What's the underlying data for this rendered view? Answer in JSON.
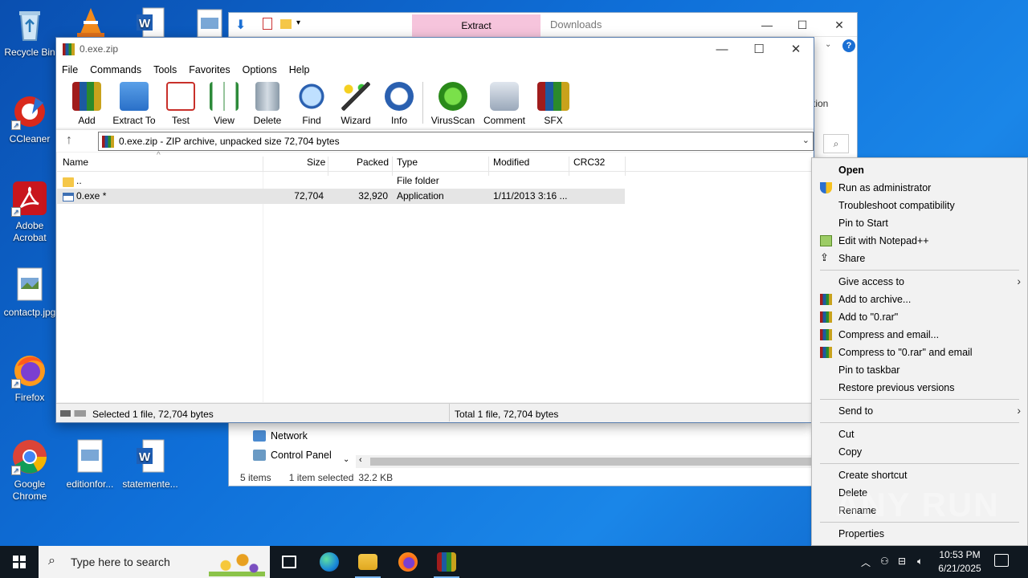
{
  "desktop": {
    "icons": [
      {
        "label": "Recycle Bin"
      },
      {
        "label": "CCleaner"
      },
      {
        "label": "Adobe Acrobat"
      },
      {
        "label": "contactp.jpg"
      },
      {
        "label": "Firefox"
      },
      {
        "label": "Google Chrome"
      },
      {
        "label": "editionfor..."
      },
      {
        "label": "statemente..."
      }
    ]
  },
  "explorer": {
    "extract_tab": "Extract",
    "title": "Downloads",
    "ribbon_partial": "tion",
    "nav": {
      "network": "Network",
      "control_panel": "Control Panel"
    },
    "status": {
      "items": "5 items",
      "selected": "1 item selected",
      "size": "32.2 KB"
    }
  },
  "winrar": {
    "title": "0.exe.zip",
    "menu": [
      "File",
      "Commands",
      "Tools",
      "Favorites",
      "Options",
      "Help"
    ],
    "toolbar": [
      "Add",
      "Extract To",
      "Test",
      "View",
      "Delete",
      "Find",
      "Wizard",
      "Info",
      "VirusScan",
      "Comment",
      "SFX"
    ],
    "address": "0.exe.zip - ZIP archive, unpacked size 72,704 bytes",
    "columns": {
      "name": "Name",
      "size": "Size",
      "packed": "Packed",
      "type": "Type",
      "modified": "Modified",
      "crc": "CRC32"
    },
    "rows": [
      {
        "name": "..",
        "size": "",
        "packed": "",
        "type": "File folder",
        "modified": ""
      },
      {
        "name": "0.exe *",
        "size": "72,704",
        "packed": "32,920",
        "type": "Application",
        "modified": "1/11/2013 3:16 ..."
      }
    ],
    "status_left": "Selected 1 file, 72,704 bytes",
    "status_right": "Total 1 file, 72,704 bytes"
  },
  "context_menu": {
    "open": "Open",
    "run_admin": "Run as administrator",
    "troubleshoot": "Troubleshoot compatibility",
    "pin_start": "Pin to Start",
    "edit_notepad": "Edit with Notepad++",
    "share": "Share",
    "give_access": "Give access to",
    "add_archive": "Add to archive...",
    "add_rar": "Add to \"0.rar\"",
    "compress_email": "Compress and email...",
    "compress_rar_email": "Compress to \"0.rar\" and email",
    "pin_taskbar": "Pin to taskbar",
    "restore": "Restore previous versions",
    "send_to": "Send to",
    "cut": "Cut",
    "copy": "Copy",
    "create_shortcut": "Create shortcut",
    "delete": "Delete",
    "rename": "Rename",
    "properties": "Properties"
  },
  "watermark": "ANY RUN",
  "taskbar": {
    "search_placeholder": "Type here to search",
    "time": "10:53 PM",
    "date": "6/21/2025"
  }
}
